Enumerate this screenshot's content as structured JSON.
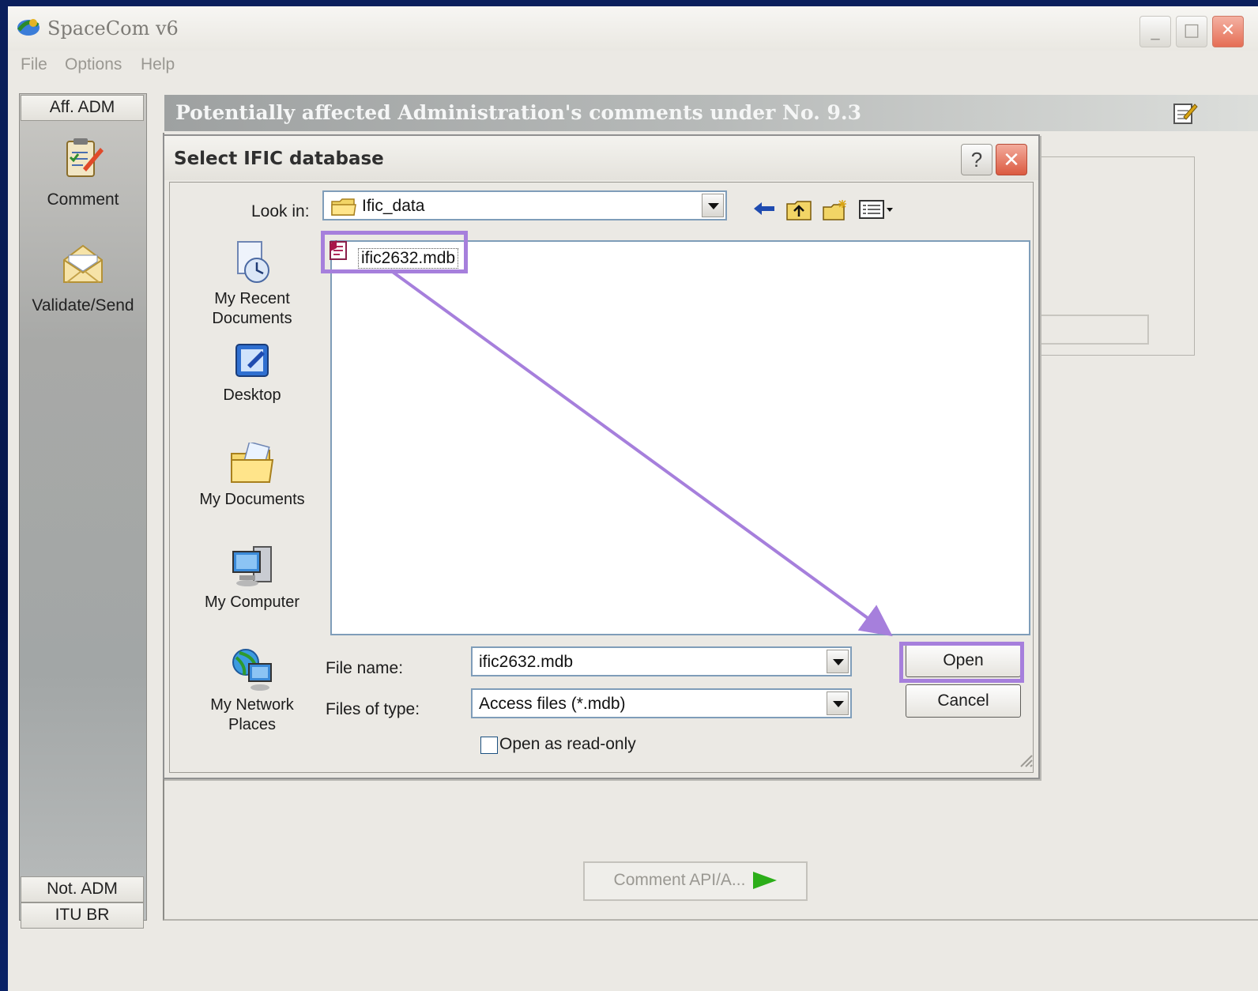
{
  "app": {
    "title": "SpaceCom v6",
    "menu": [
      "File",
      "Options",
      "Help"
    ]
  },
  "sidebar": {
    "top_tab": "Aff. ADM",
    "buttons": [
      {
        "label": "Comment",
        "icon": "clipboard-edit-icon"
      },
      {
        "label": "Validate/Send",
        "icon": "envelope-icon"
      }
    ],
    "bottom_tabs": [
      "Not. ADM",
      "ITU BR"
    ]
  },
  "main": {
    "header_title": "Potentially affected Administration's comments under No. 9.3",
    "header_icon": "edit-note-icon",
    "comment_button": "Comment API/A..."
  },
  "dialog": {
    "title": "Select IFIC database",
    "look_in_label": "Look in:",
    "look_in_value": "Ific_data",
    "places": [
      "My Recent Documents",
      "Desktop",
      "My Documents",
      "My Computer",
      "My Network Places"
    ],
    "files": [
      {
        "name": "ific2632.mdb",
        "icon": "access-file-icon"
      }
    ],
    "file_name_label": "File name:",
    "file_name_value": "ific2632.mdb",
    "file_type_label": "Files of type:",
    "file_type_value": "Access files (*.mdb)",
    "readonly_label": "Open as read-only",
    "readonly_checked": false,
    "open_button": "Open",
    "cancel_button": "Cancel"
  },
  "annotation": {
    "color": "#a67fdc"
  }
}
